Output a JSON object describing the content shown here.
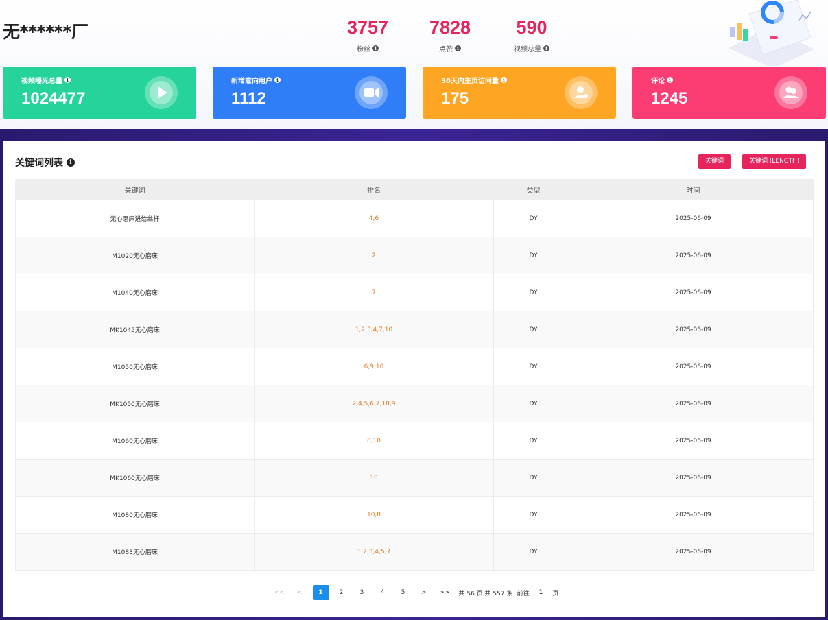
{
  "header": {
    "title": "无******厂",
    "stats": [
      {
        "value": "3757",
        "label": "粉丝"
      },
      {
        "value": "7828",
        "label": "点赞"
      },
      {
        "value": "590",
        "label": "视频总量"
      }
    ]
  },
  "cards": [
    {
      "label": "视频曝光总量",
      "value": "1024477",
      "color": "#26d39a",
      "icon": "play-icon"
    },
    {
      "label": "新增意向用户",
      "value": "1112",
      "color": "#307df8",
      "icon": "video-camera-icon"
    },
    {
      "label": "30天内主页访问量",
      "value": "175",
      "color": "#ffa524",
      "icon": "user-icon"
    },
    {
      "label": "评论",
      "value": "1245",
      "color": "#fb3d73",
      "icon": "users-icon"
    }
  ],
  "panel": {
    "title": "关键词列表",
    "btn_keyword": "关键词",
    "btn_keyword_length": "关键词 (LENGTH)"
  },
  "table": {
    "headers": [
      "关键词",
      "排名",
      "类型",
      "时间"
    ],
    "rows": [
      [
        "无心磨床进给丝杆",
        "4,6",
        "DY",
        "2025-06-09"
      ],
      [
        "M1020无心磨床",
        "2",
        "DY",
        "2025-06-09"
      ],
      [
        "M1040无心磨床",
        "7",
        "DY",
        "2025-06-09"
      ],
      [
        "MK1045无心磨床",
        "1,2,3,4,7,10",
        "DY",
        "2025-06-09"
      ],
      [
        "M1050无心磨床",
        "6,9,10",
        "DY",
        "2025-06-09"
      ],
      [
        "MK1050无心磨床",
        "2,4,5,6,7,10,9",
        "DY",
        "2025-06-09"
      ],
      [
        "M1060无心磨床",
        "8,10",
        "DY",
        "2025-06-09"
      ],
      [
        "MK1060无心磨床",
        "10",
        "DY",
        "2025-06-09"
      ],
      [
        "M1080无心磨床",
        "10,8",
        "DY",
        "2025-06-09"
      ],
      [
        "M1083无心磨床",
        "1,2,3,4,5,7",
        "DY",
        "2025-06-09"
      ]
    ]
  },
  "pagination": {
    "first": "<<",
    "prev": "<",
    "pages": [
      "1",
      "2",
      "3",
      "4",
      "5"
    ],
    "current": "1",
    "next": ">",
    "last": ">>",
    "summary": "共 56 页 共 557 条",
    "goto_label": "前往",
    "goto_value": "1",
    "goto_suffix": "页"
  },
  "colors": {
    "accent": "#e6255c",
    "rank": "#e6781e",
    "page_active": "#1a8ee8",
    "band": "#3b2494"
  }
}
